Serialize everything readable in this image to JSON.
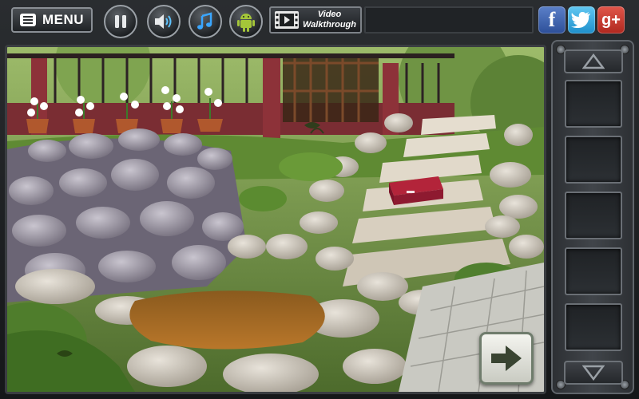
{
  "topbar": {
    "menu_label": "MENU",
    "video_line1": "Video",
    "video_line2": "Walkthrough",
    "icons": {
      "pause": "pause-icon",
      "sound": "speaker-icon",
      "music": "music-note-icon",
      "android": "android-icon",
      "video": "film-icon"
    },
    "social": {
      "facebook_glyph": "f",
      "gplus_glyph": "g+"
    }
  },
  "inventory": {
    "slots": 5
  },
  "colors": {
    "accent": "#9aa0a6",
    "facebook": "#3b5998",
    "twitter": "#1da1f2",
    "gplus": "#d34836",
    "next_arrow": "#394431"
  }
}
